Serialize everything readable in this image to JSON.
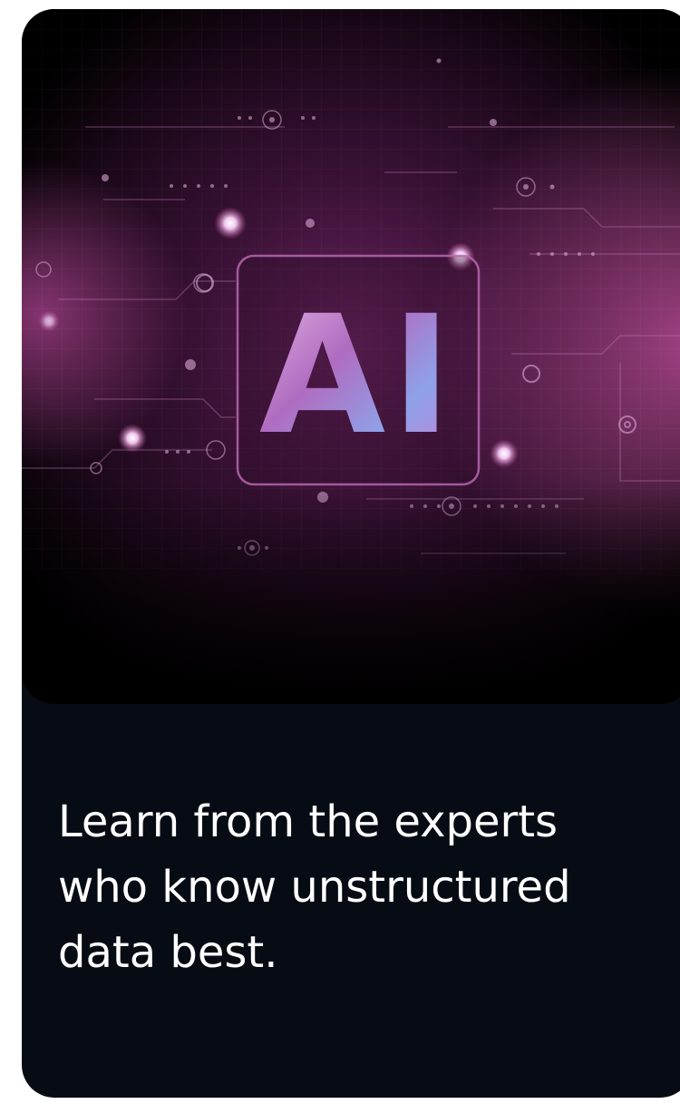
{
  "hero": {
    "badge_text": "AI",
    "icon": "ai-circuit-chip-icon",
    "colors": {
      "glow": "#b0488f",
      "frame": "#a14e96",
      "background": "#000000"
    }
  },
  "headline": {
    "line1": "Learn from the experts",
    "line2": "who know unstructured",
    "line3": "data best."
  },
  "card": {
    "background": "#070b14",
    "text_color": "#ffffff"
  }
}
